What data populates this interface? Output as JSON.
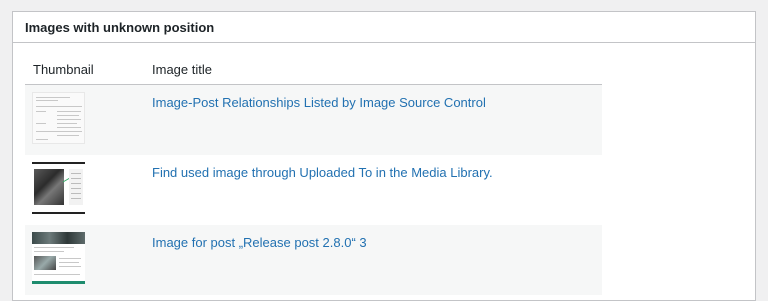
{
  "panel": {
    "title": "Images with unknown position"
  },
  "table": {
    "headers": {
      "thumbnail": "Thumbnail",
      "image_title": "Image title"
    },
    "rows": [
      {
        "title": "Image-Post Relationships Listed by Image Source Control",
        "thumbnail_icon": "admin-list-screenshot"
      },
      {
        "title": "Find used image through Uploaded To in the Media Library.",
        "thumbnail_icon": "media-library-screenshot"
      },
      {
        "title": "Image for post „Release post 2.8.0“ 3",
        "thumbnail_icon": "post-photo-screenshot"
      }
    ]
  },
  "colors": {
    "link": "#2271b1",
    "alt_row": "#f6f7f7",
    "border": "#c3c4c7",
    "page_bg": "#f0f0f1"
  }
}
